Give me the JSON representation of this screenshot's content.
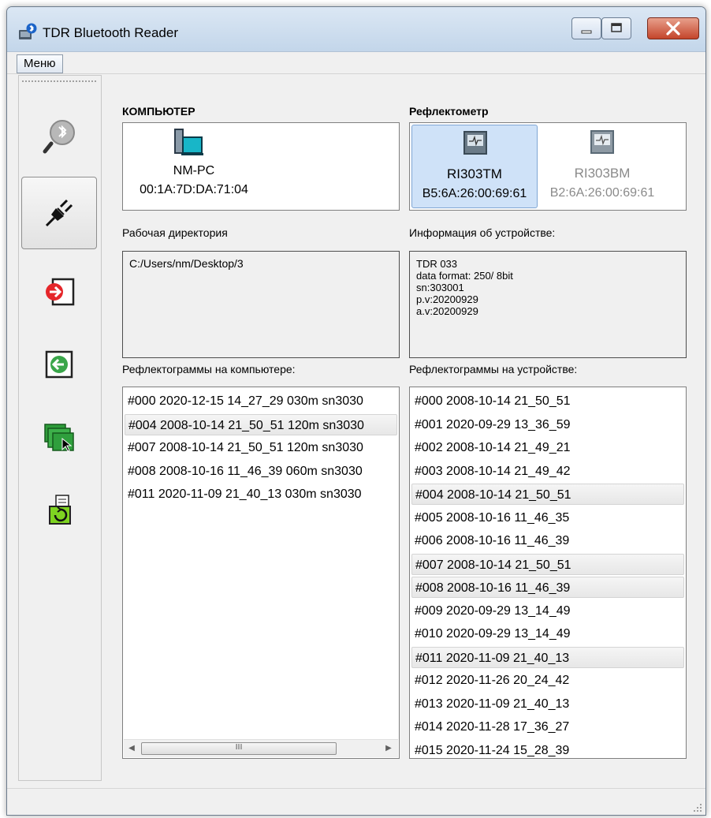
{
  "window": {
    "title": "TDR Bluetooth Reader"
  },
  "menu": {
    "label": "Меню"
  },
  "sidebar": {
    "items": [
      {
        "name": "bluetooth-search",
        "icon": "bluetooth-magnifier-icon"
      },
      {
        "name": "connect",
        "icon": "plug-icon",
        "active": true
      },
      {
        "name": "export",
        "icon": "export-red-arrow-icon"
      },
      {
        "name": "import",
        "icon": "import-green-arrow-icon"
      },
      {
        "name": "open-folder",
        "icon": "folder-cursor-icon"
      },
      {
        "name": "refresh",
        "icon": "refresh-document-icon"
      }
    ]
  },
  "computer": {
    "heading": "КОМПЬЮТЕР",
    "name": "NM-PC",
    "mac": "00:1A:7D:DA:71:04"
  },
  "reflectometer": {
    "heading": "Рефлектометр",
    "devices": [
      {
        "name": "RI303TM",
        "mac": "B5:6A:26:00:69:61",
        "selected": true
      },
      {
        "name": "RI303BM",
        "mac": "B2:6A:26:00:69:61",
        "selected": false
      }
    ]
  },
  "workdir": {
    "label": "Рабочая директория",
    "path": "C:/Users/nm/Desktop/3"
  },
  "device_info": {
    "label": "Информация об устройстве:",
    "text": "TDR 033\ndata format: 250/ 8bit\nsn:303001\np.v:20200929\na.v:20200929"
  },
  "pc_list": {
    "label": "Рефлектограммы на компьютере:",
    "rows": [
      {
        "text": "#000 2020-12-15 14_27_29 030m sn3030",
        "hl": false
      },
      {
        "text": "#004 2008-10-14 21_50_51 120m sn3030",
        "hl": true
      },
      {
        "text": "#007 2008-10-14 21_50_51 120m sn3030",
        "hl": false
      },
      {
        "text": "#008 2008-10-16 11_46_39 060m sn3030",
        "hl": false
      },
      {
        "text": "#011 2020-11-09 21_40_13 030m sn3030",
        "hl": false
      }
    ],
    "scroll_grip": "III"
  },
  "device_list": {
    "label": "Рефлектограммы на устройстве:",
    "rows": [
      {
        "text": "#000 2008-10-14 21_50_51",
        "hl": false
      },
      {
        "text": "#001 2020-09-29 13_36_59",
        "hl": false
      },
      {
        "text": "#002 2008-10-14 21_49_21",
        "hl": false
      },
      {
        "text": "#003 2008-10-14 21_49_42",
        "hl": false
      },
      {
        "text": "#004 2008-10-14 21_50_51",
        "hl": true
      },
      {
        "text": "#005 2008-10-16 11_46_35",
        "hl": false
      },
      {
        "text": "#006 2008-10-16 11_46_39",
        "hl": false
      },
      {
        "text": "#007 2008-10-14 21_50_51",
        "hl": true
      },
      {
        "text": "#008 2008-10-16 11_46_39",
        "hl": true
      },
      {
        "text": "#009 2020-09-29 13_14_49",
        "hl": false
      },
      {
        "text": "#010 2020-09-29 13_14_49",
        "hl": false
      },
      {
        "text": "#011 2020-11-09 21_40_13",
        "hl": true
      },
      {
        "text": "#012 2020-11-26 20_24_42",
        "hl": false
      },
      {
        "text": "#013 2020-11-09 21_40_13",
        "hl": false
      },
      {
        "text": "#014 2020-11-28 17_36_27",
        "hl": false
      },
      {
        "text": "#015 2020-11-24 15_28_39",
        "hl": false
      }
    ]
  }
}
